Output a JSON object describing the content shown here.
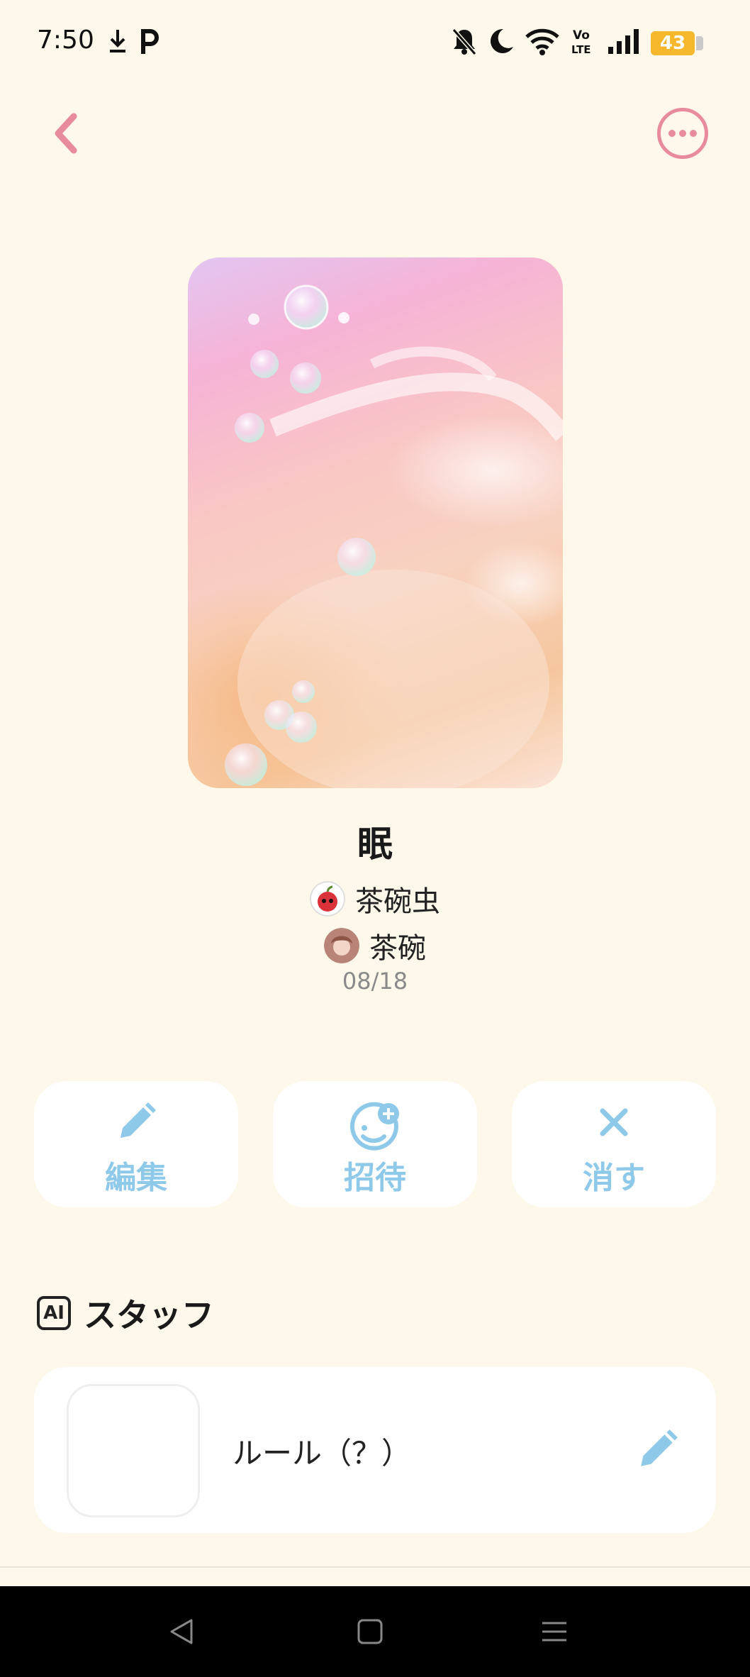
{
  "status_bar": {
    "time": "7:50",
    "battery": "43",
    "icons": [
      "download-icon",
      "p-app-icon",
      "bell-off-icon",
      "moon-icon",
      "wifi-icon",
      "volte-icon",
      "signal-icon",
      "battery-icon"
    ]
  },
  "header": {
    "back_icon": "chevron-left-icon",
    "more_icon": "more-horizontal-icon"
  },
  "room": {
    "title": "眠",
    "members": [
      {
        "name": "茶碗虫",
        "avatar": "apple-avatar"
      },
      {
        "name": "茶碗",
        "avatar": "girl-avatar"
      }
    ],
    "date": "08/18"
  },
  "actions": [
    {
      "label": "編集",
      "icon": "pencil-icon"
    },
    {
      "label": "招待",
      "icon": "invite-smile-icon"
    },
    {
      "label": "消す",
      "icon": "close-icon"
    }
  ],
  "staff_section": {
    "badge": "AI",
    "title": "スタッフ",
    "items": [
      {
        "name": "ルール（？）",
        "edit_icon": "pencil-icon"
      }
    ]
  },
  "nav_bar": {
    "buttons": [
      "back-triangle-icon",
      "home-square-icon",
      "menu-lines-icon"
    ]
  },
  "colors": {
    "background": "#fdf8ea",
    "accent_pink": "#e88b9c",
    "accent_blue": "#8fc9ea",
    "battery": "#f5b72c"
  }
}
